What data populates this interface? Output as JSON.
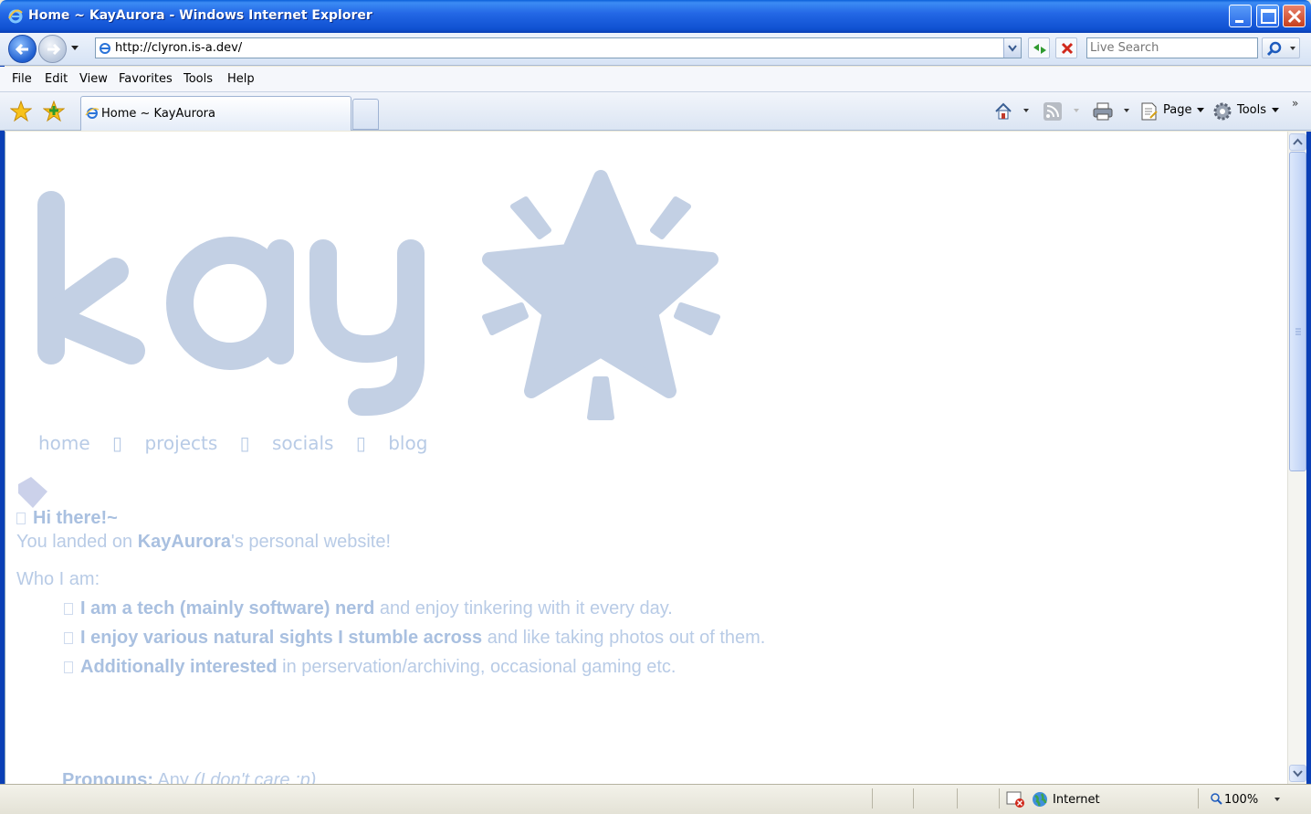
{
  "window": {
    "title": "Home ~ KayAurora - Windows Internet Explorer"
  },
  "address": {
    "url": "http://clyron.is-a.dev/",
    "search_placeholder": "Live Search"
  },
  "menu": {
    "items": [
      "File",
      "Edit",
      "View",
      "Favorites",
      "Tools",
      "Help"
    ]
  },
  "tabs": {
    "active_label": "Home ~ KayAurora"
  },
  "commands": {
    "page_label": "Page",
    "tools_label": "Tools"
  },
  "page": {
    "nav": [
      "home",
      "projects",
      "socials",
      "blog"
    ],
    "greeting": "Hi there!~",
    "intro_prefix": "You landed on ",
    "intro_name": "KayAurora",
    "intro_suffix": "'s personal website!",
    "who_heading": "Who I am:",
    "items": [
      {
        "bold": "I am a tech (mainly software) nerd",
        "rest": " and enjoy tinkering with it every day."
      },
      {
        "bold": "I enjoy various natural sights I stumble across",
        "rest": " and like taking photos out of them."
      },
      {
        "bold": "Additionally interested",
        "rest": " in perservation/archiving, occasional gaming etc."
      }
    ],
    "pronouns_label": "Pronouns:",
    "pronouns_value": " Any ",
    "pronouns_note": "(I don't care :p)"
  },
  "status": {
    "zone": "Internet",
    "zoom": "100%"
  },
  "colors": {
    "accent": "#b8cbe6",
    "frame": "#0a3fb5"
  }
}
